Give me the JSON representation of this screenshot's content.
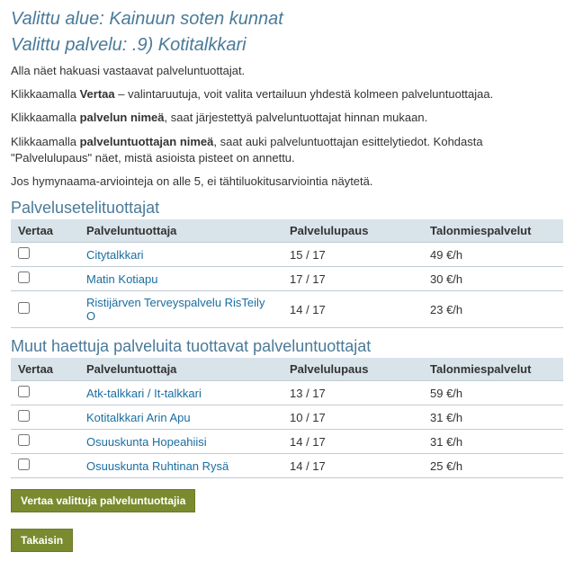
{
  "headers": {
    "selected_area": "Valittu alue: Kainuun soten kunnat",
    "selected_service": "Valittu palvelu: .9) Kotitalkkari"
  },
  "intro": {
    "p1": "Alla näet hakuasi vastaavat palveluntuottajat.",
    "p2a": "Klikkaamalla ",
    "p2b": "Vertaa",
    "p2c": " – valintaruutuja, voit valita vertailuun yhdestä kolmeen palveluntuottajaa.",
    "p3a": "Klikkaamalla ",
    "p3b": "palvelun nimeä",
    "p3c": ", saat järjestettyä palveluntuottajat hinnan mukaan.",
    "p4a": "Klikkaamalla ",
    "p4b": "palveluntuottajan nimeä",
    "p4c": ", saat auki palveluntuottajan esittelytiedot. Kohdasta \"Palvelulupaus\" näet, mistä asioista pisteet on annettu.",
    "p5": "Jos hymynaama-arviointeja on alle 5, ei tähtiluokitusarviointia näytetä."
  },
  "sections": {
    "voucher_heading": "Palvelusetelituottajat",
    "other_heading": "Muut haettuja palveluita tuottavat palveluntuottajat"
  },
  "table_headers": {
    "vertaa": "Vertaa",
    "provider": "Palveluntuottaja",
    "lupaus": "Palvelulupaus",
    "service_col": "Talonmiespalvelut"
  },
  "voucher_rows": [
    {
      "name": "Citytalkkari",
      "lupaus": "15 / 17",
      "price": "49 €/h"
    },
    {
      "name": "Matin Kotiapu",
      "lupaus": "17 / 17",
      "price": "30 €/h"
    },
    {
      "name": "Ristijärven Terveyspalvelu RisTeily O",
      "lupaus": "14 / 17",
      "price": "23 €/h"
    }
  ],
  "other_rows": [
    {
      "name": "Atk-talkkari / It-talkkari",
      "lupaus": "13 / 17",
      "price": "59 €/h"
    },
    {
      "name": "Kotitalkkari Arin Apu",
      "lupaus": "10 / 17",
      "price": "31 €/h"
    },
    {
      "name": "Osuuskunta Hopeahiisi",
      "lupaus": "14 / 17",
      "price": "31 €/h"
    },
    {
      "name": "Osuuskunta Ruhtinan Rysä",
      "lupaus": "14 / 17",
      "price": "25 €/h"
    }
  ],
  "buttons": {
    "compare": "Vertaa valittuja palveluntuottajia",
    "back": "Takaisin"
  }
}
